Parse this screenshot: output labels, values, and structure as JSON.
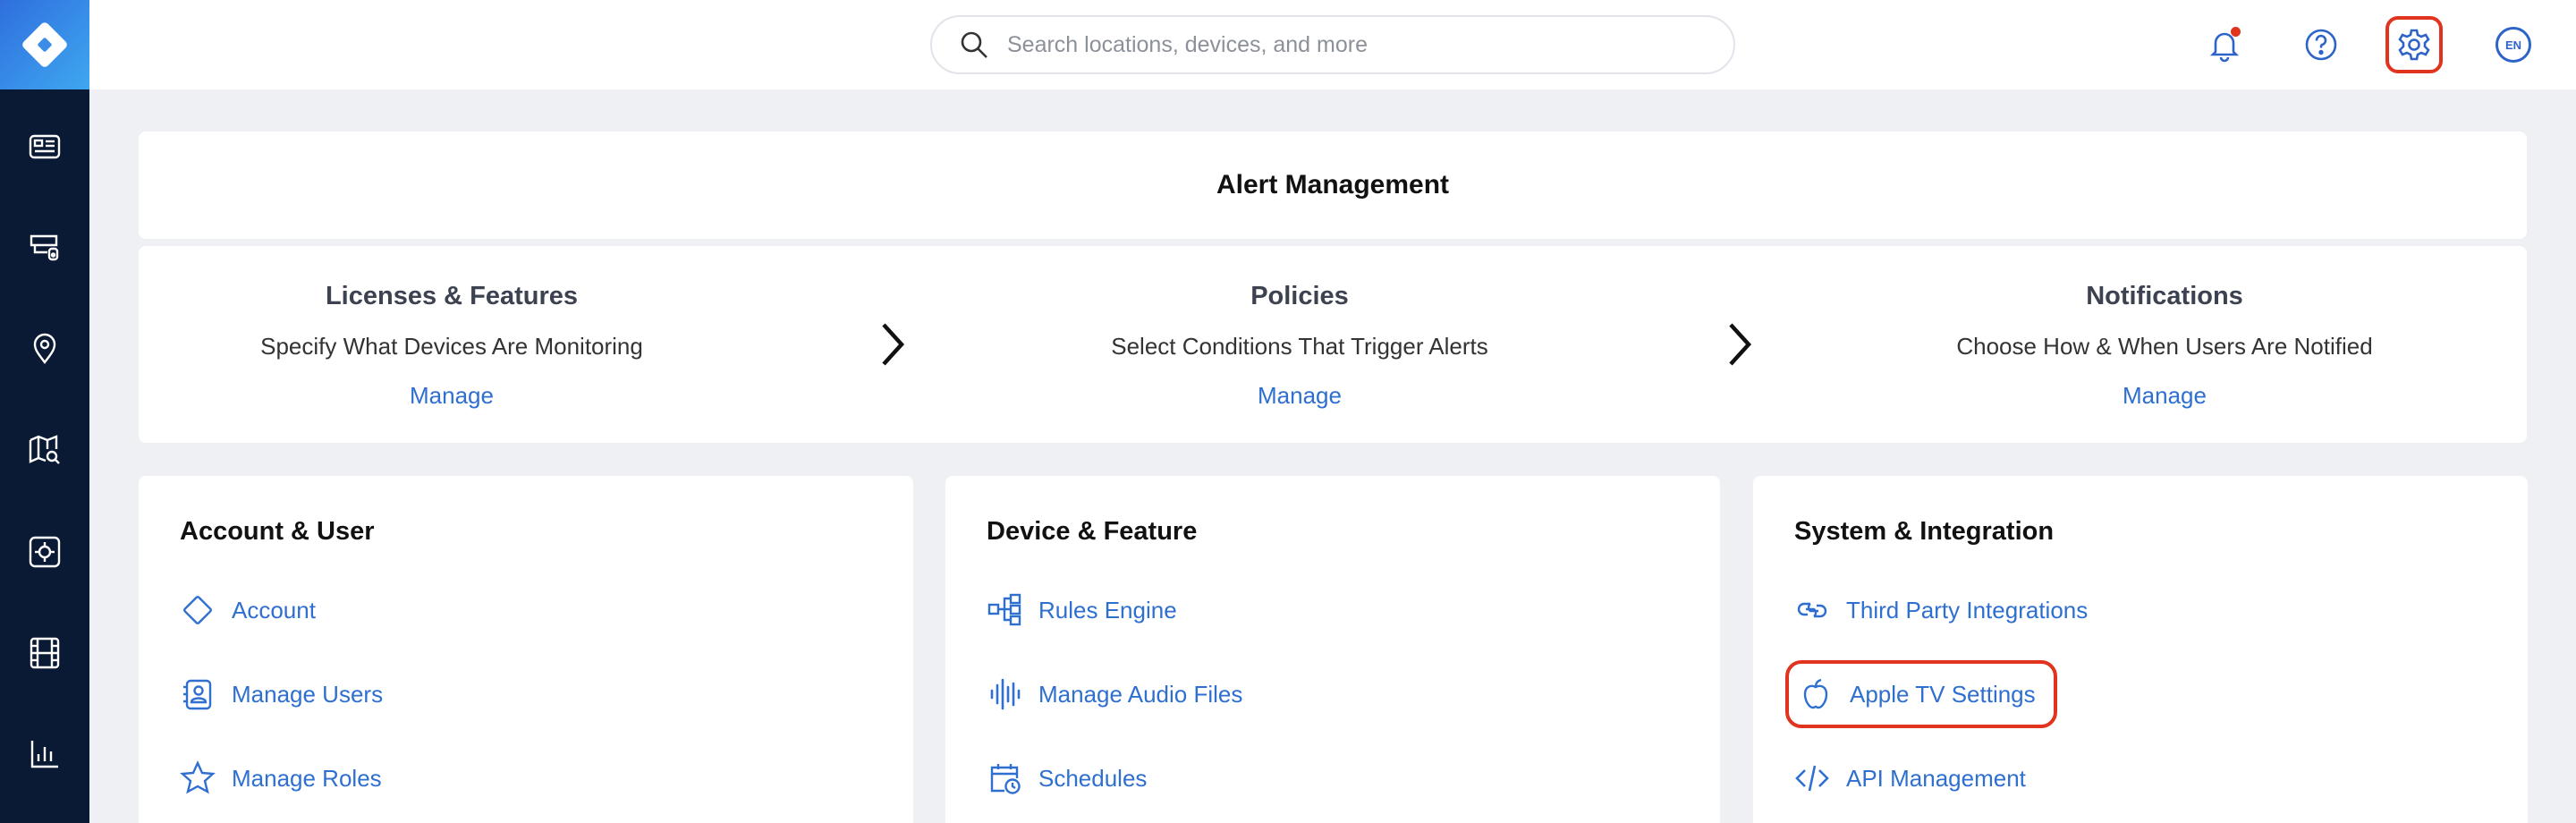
{
  "search": {
    "placeholder": "Search locations, devices, and more"
  },
  "topbar": {
    "lang": "EN"
  },
  "alert_management": {
    "title": "Alert Management",
    "steps": [
      {
        "title": "Licenses & Features",
        "desc": "Specify What Devices Are Monitoring",
        "action": "Manage"
      },
      {
        "title": "Policies",
        "desc": "Select Conditions That Trigger Alerts",
        "action": "Manage"
      },
      {
        "title": "Notifications",
        "desc": "Choose How & When Users Are Notified",
        "action": "Manage"
      }
    ]
  },
  "sections": [
    {
      "title": "Account & User",
      "items": [
        "Account",
        "Manage Users",
        "Manage Roles"
      ]
    },
    {
      "title": "Device & Feature",
      "items": [
        "Rules Engine",
        "Manage Audio Files",
        "Schedules"
      ]
    },
    {
      "title": "System & Integration",
      "items": [
        "Third Party Integrations",
        "Apple TV Settings",
        "API Management"
      ]
    }
  ],
  "colors": {
    "accent": "#2e6fd0",
    "sidebar": "#0b1a34",
    "highlight": "#e0341f",
    "notification_dot": "#e0341f"
  }
}
